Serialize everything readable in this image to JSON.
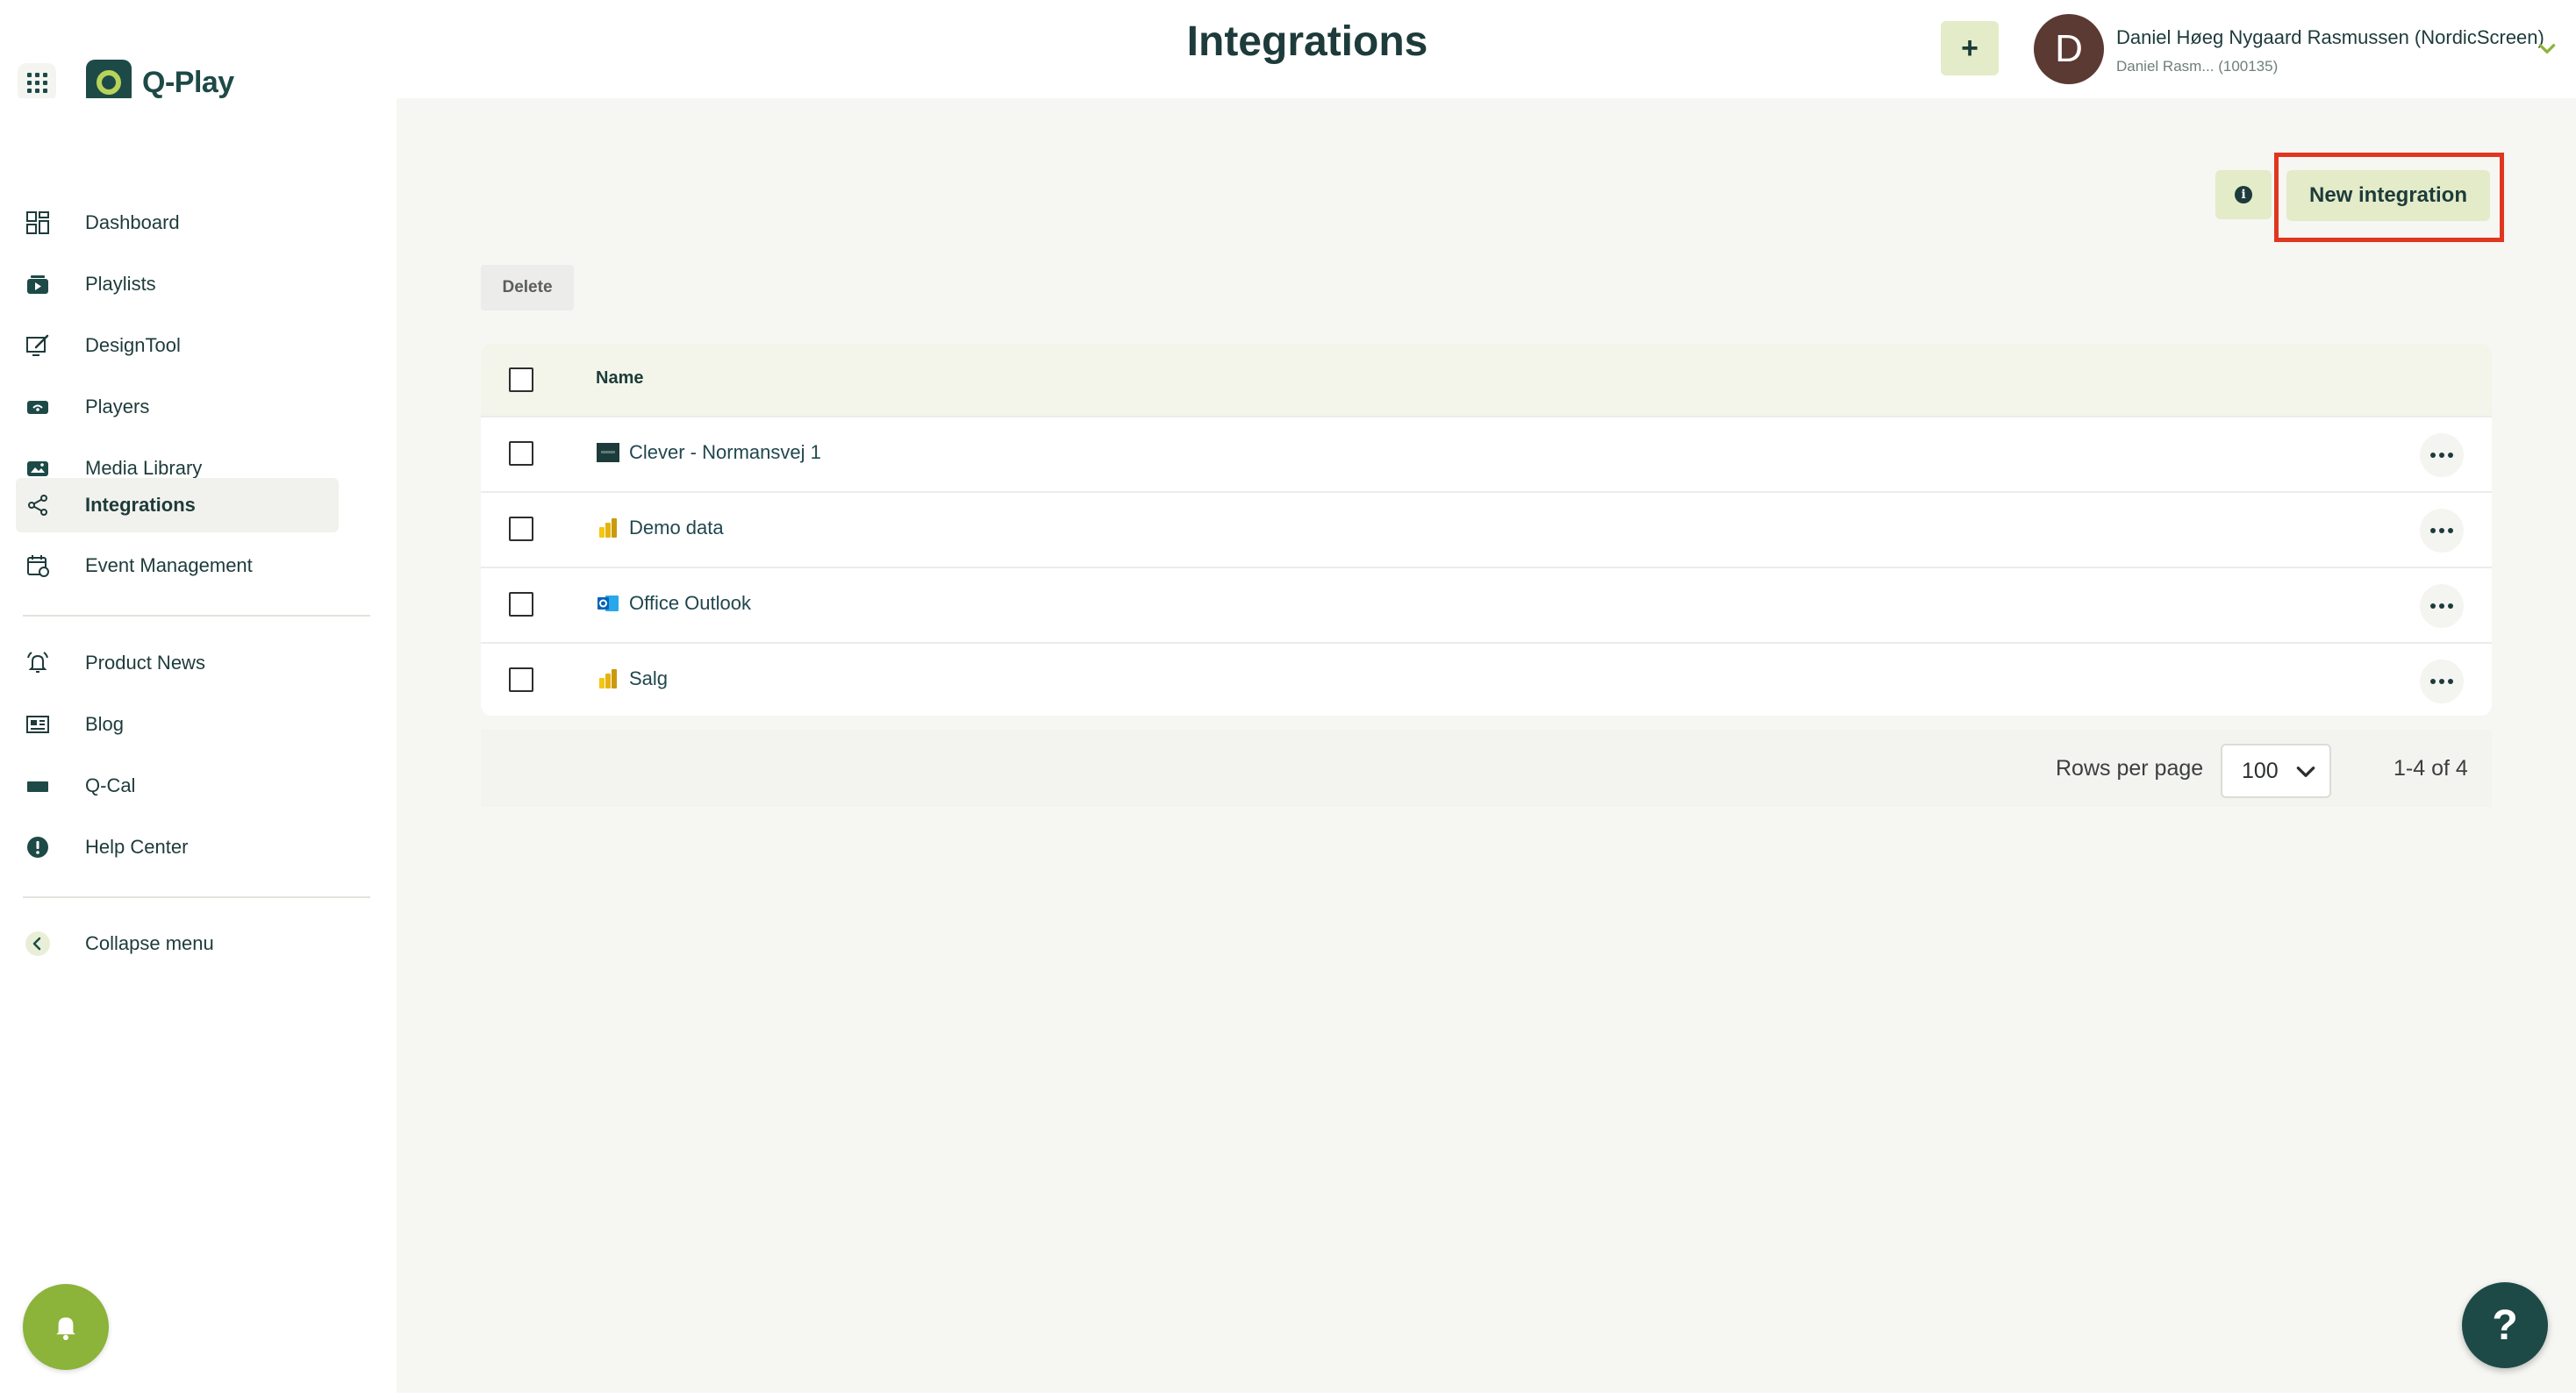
{
  "app": {
    "name": "Q-Play"
  },
  "header": {
    "title": "Integrations",
    "add_label": "+",
    "user": {
      "initial": "D",
      "name": "Daniel Høeg Nygaard Rasmussen (NordicScreen)",
      "sub": "Daniel Rasm... (100135)"
    }
  },
  "sidebar": {
    "items": [
      {
        "label": "Dashboard",
        "icon": "dashboard-icon"
      },
      {
        "label": "Playlists",
        "icon": "playlist-icon"
      },
      {
        "label": "DesignTool",
        "icon": "design-tool-icon"
      },
      {
        "label": "Players",
        "icon": "player-icon"
      },
      {
        "label": "Media Library",
        "icon": "media-library-icon"
      },
      {
        "label": "Integrations",
        "icon": "integrations-icon",
        "active": true
      },
      {
        "label": "Event Management",
        "icon": "calendar-icon"
      }
    ],
    "secondary_items": [
      {
        "label": "Product News",
        "icon": "bell-ring-icon"
      },
      {
        "label": "Blog",
        "icon": "newspaper-icon"
      },
      {
        "label": "Q-Cal",
        "icon": "q-cal-icon"
      },
      {
        "label": "Help Center",
        "icon": "help-center-icon"
      }
    ],
    "collapse_label": "Collapse menu"
  },
  "toolbar": {
    "new_integration_label": "New integration",
    "delete_label": "Delete"
  },
  "table": {
    "column_name": "Name",
    "rows": [
      {
        "name": "Clever - Normansvej 1",
        "icon": "clever-icon"
      },
      {
        "name": "Demo data",
        "icon": "power-bi-icon"
      },
      {
        "name": "Office Outlook",
        "icon": "outlook-icon"
      },
      {
        "name": "Salg",
        "icon": "power-bi-icon"
      }
    ]
  },
  "pagination": {
    "rows_per_page_label": "Rows per page",
    "rows_per_page_value": "100",
    "range": "1-4 of 4"
  },
  "help": {
    "label": "?"
  },
  "colors": {
    "brand": "#1d4a47",
    "accent_green": "#8cb33a",
    "button_bg": "#e4ebc8",
    "highlight_border": "#e0361f"
  }
}
